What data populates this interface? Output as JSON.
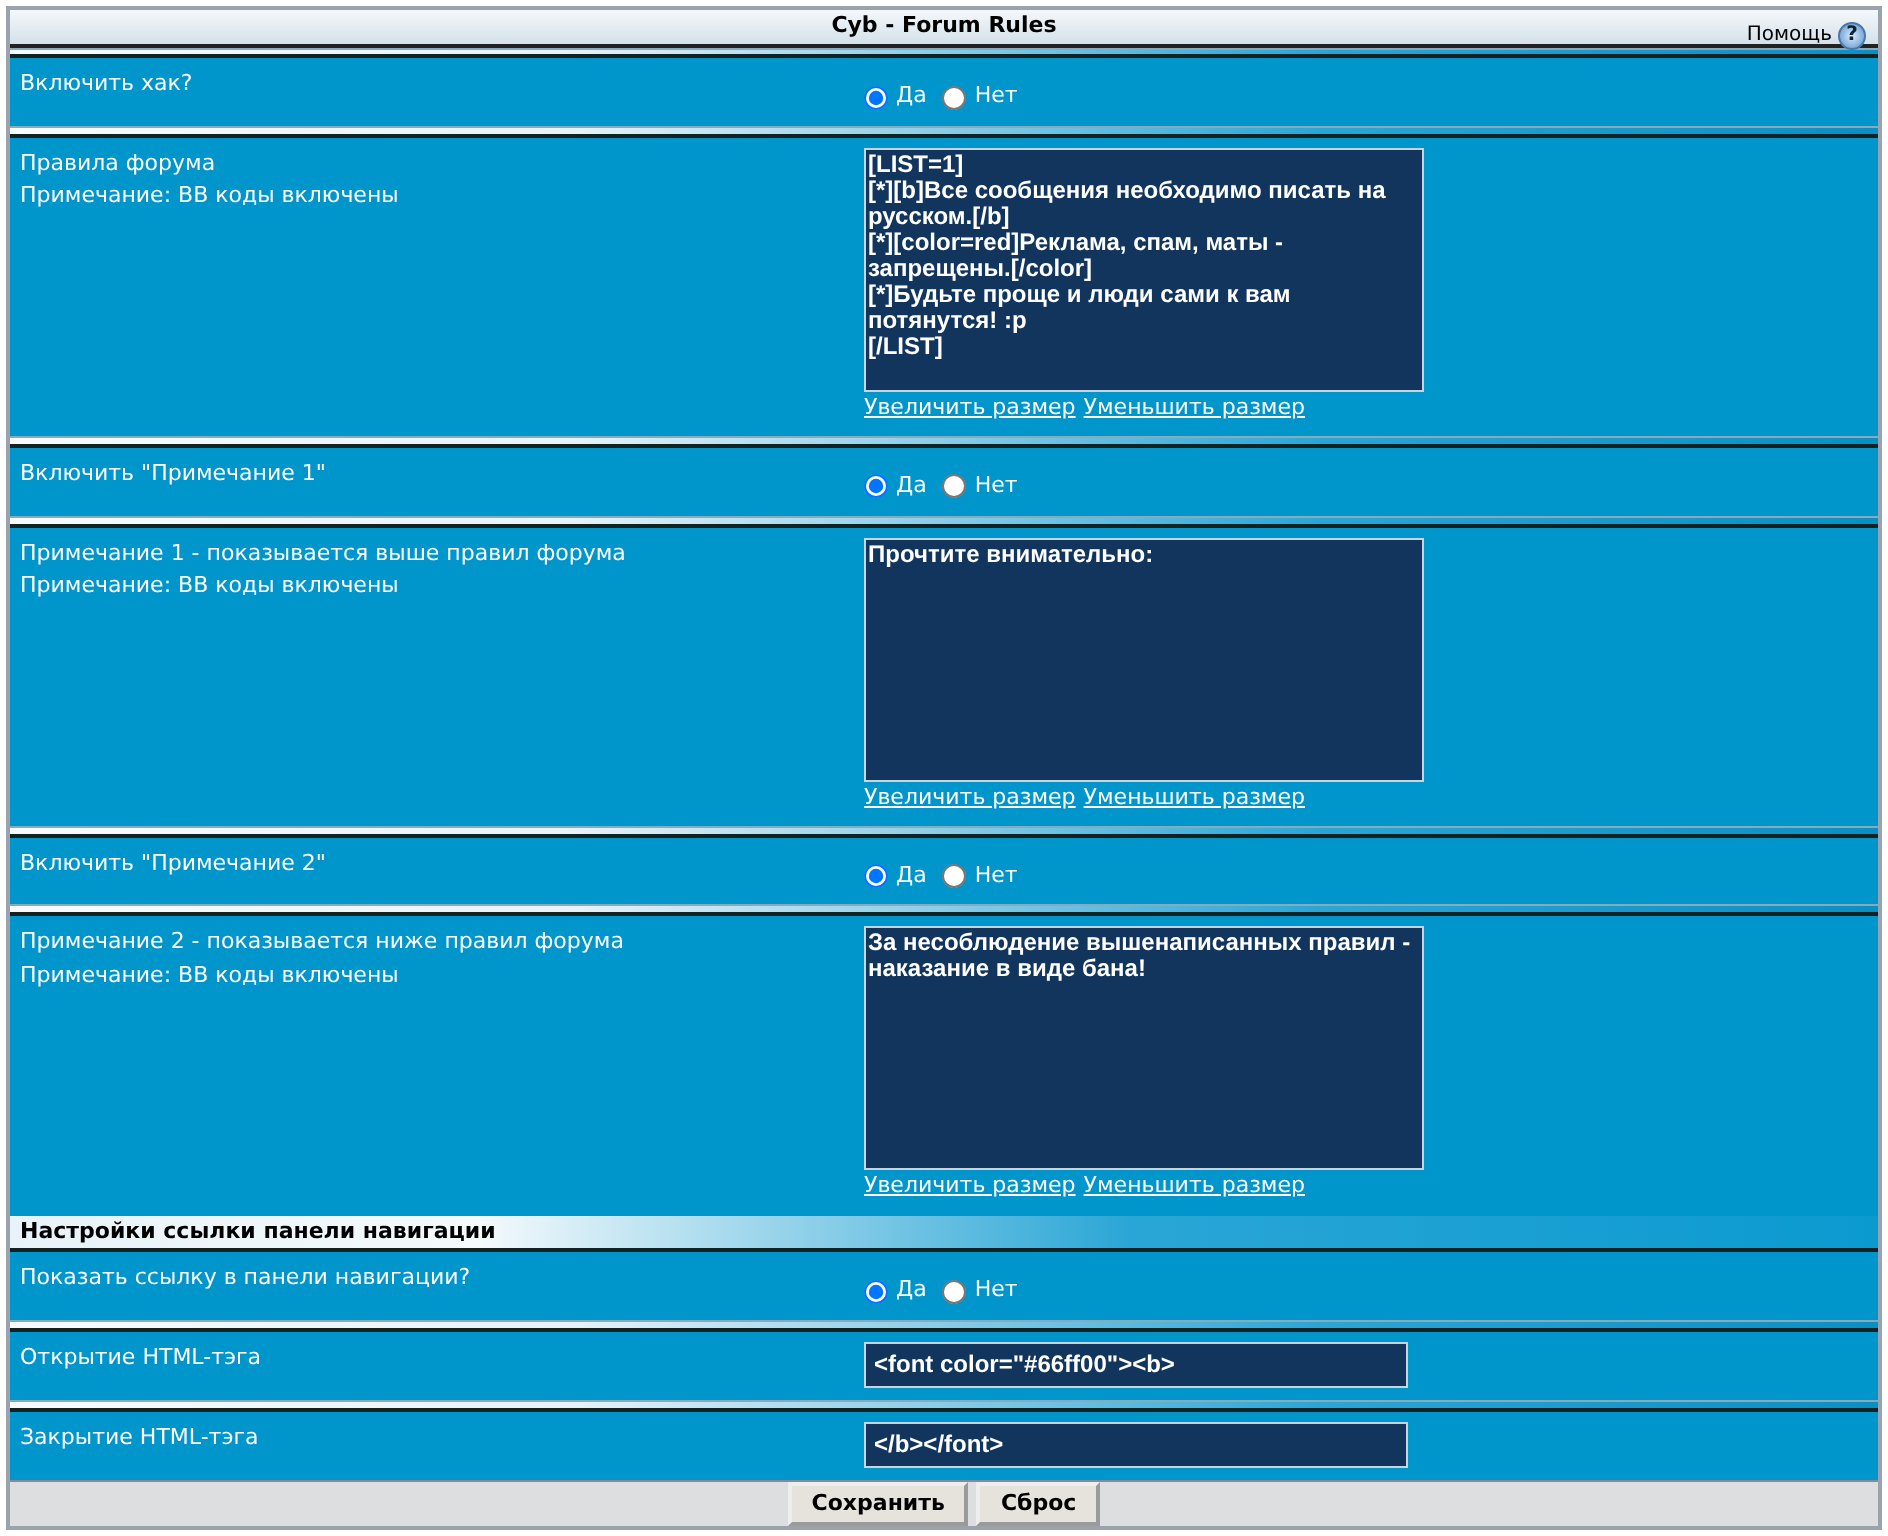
{
  "window": {
    "title": "Cyb - Forum Rules",
    "help": "Помощь",
    "help_icon": "?"
  },
  "rows": [
    {
      "kind": "radio",
      "label": "Включить хак?",
      "options": [
        {
          "label": "Да",
          "selected": true
        },
        {
          "label": "Нет",
          "selected": false
        }
      ]
    },
    {
      "kind": "textarea",
      "label": "Правила форума",
      "note": "Примечание: BB коды включены",
      "value": "[LIST=1]\n[*][b]Все сообщения необходимо писать на русском.[/b]\n[*][color=red]Реклама, спам, маты - запрещены.[/color]\n[*]Будьте проще и люди сами к вам потянутся! :p\n[/LIST]",
      "links": [
        "Увеличить размер",
        "Уменьшить размер"
      ]
    },
    {
      "kind": "radio",
      "label": "Включить \"Примечание 1\"",
      "options": [
        {
          "label": "Да",
          "selected": true
        },
        {
          "label": "Нет",
          "selected": false
        }
      ]
    },
    {
      "kind": "textarea",
      "label": "Примечание 1 - показывается выше правил форума",
      "note": "Примечание: BB коды включены",
      "value": "Прочтите внимательно:",
      "links": [
        "Увеличить размер",
        "Уменьшить размер"
      ]
    },
    {
      "kind": "radio",
      "label": "Включить \"Примечание 2\"",
      "options": [
        {
          "label": "Да",
          "selected": true
        },
        {
          "label": "Нет",
          "selected": false
        }
      ]
    },
    {
      "kind": "textarea",
      "label": "Примечание 2 - показывается ниже правил форума",
      "note": "Примечание: BB коды включены",
      "value": "За несоблюдение вышенаписанных правил - наказание в виде бана!",
      "links": [
        "Увеличить размер",
        "Уменьшить размер"
      ]
    },
    {
      "kind": "header",
      "label": "Настройки ссылки панели навигации"
    },
    {
      "kind": "radio",
      "label": "Показать ссылку в панели навигации?",
      "options": [
        {
          "label": "Да",
          "selected": true
        },
        {
          "label": "Нет",
          "selected": false
        }
      ]
    },
    {
      "kind": "text",
      "label": "Открытие HTML-тэга",
      "value": "<font color=\"#66ff00\"><b>"
    },
    {
      "kind": "text",
      "label": "Закрытие HTML-тэга",
      "value": "</b></font>"
    }
  ],
  "buttons": [
    "Сохранить",
    "Сброс"
  ]
}
